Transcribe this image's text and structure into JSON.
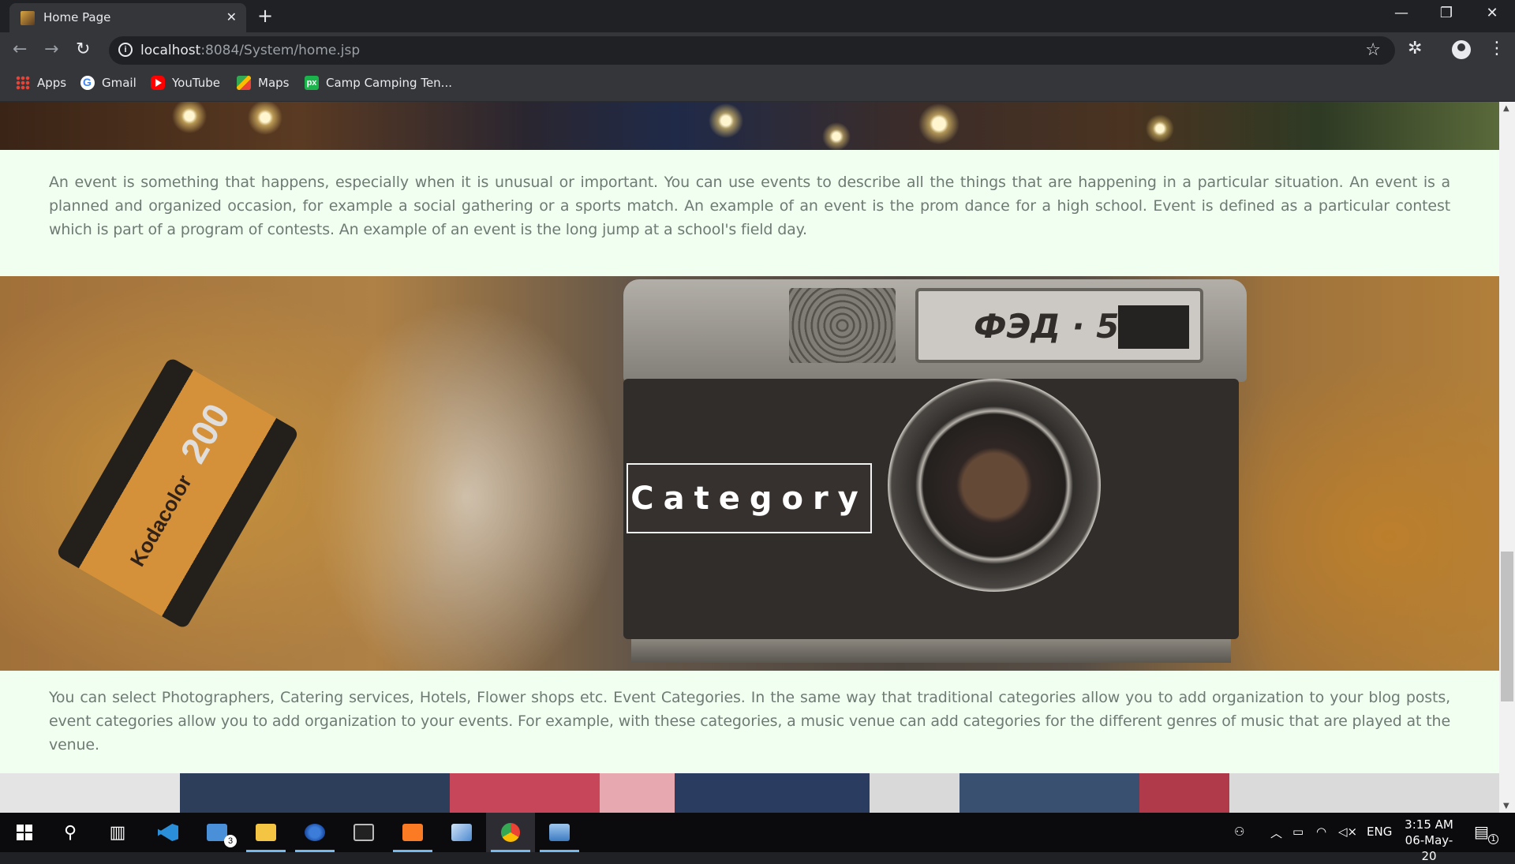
{
  "browser": {
    "tab_title": "Home Page",
    "tab_close": "✕",
    "new_tab": "+",
    "window_controls": {
      "minimize": "—",
      "restore": "❐",
      "close": "✕"
    },
    "nav": {
      "back": "←",
      "forward": "→",
      "reload": "↻"
    },
    "url_host": "localhost",
    "url_path": ":8084/System/home.jsp",
    "bookmark_star": "☆",
    "menu": "⋮"
  },
  "bookmarks": [
    {
      "label": "Apps",
      "icon": "apps-grid-icon"
    },
    {
      "label": "Gmail",
      "icon": "google-icon"
    },
    {
      "label": "YouTube",
      "icon": "youtube-icon"
    },
    {
      "label": "Maps",
      "icon": "maps-icon"
    },
    {
      "label": "Camp Camping Ten...",
      "icon": "px-icon"
    }
  ],
  "page": {
    "event_text": "An event is something that happens, especially when it is unusual or important. You can use events to describe all the things that are happening in a particular situation. An event is a planned and organized occasion, for example a social gathering or a sports match. An example of an event is the prom dance for a high school. Event is defined as a particular contest which is part of a program of contests. An example of an event is the long jump at a school's field day.",
    "category_heading": "Category",
    "category_text": "You can select Photographers, Catering services, Hotels, Flower shops etc. Event Categories. In the same way that traditional categories allow you to add organization to your blog posts, event categories allow you to add organization to your events. For example, with these categories, a music venue can add categories for the different genres of music that are played at the venue."
  },
  "hero_image_text": {
    "camera_model": "ФЭД · 5",
    "film_brand": "Kodacolor",
    "film_speed": "200"
  },
  "taskbar": {
    "mail_badge": "3",
    "tray_language": "ENG",
    "time": "3:15 AM",
    "date": "06-May-20",
    "notification_count": "1"
  },
  "colors": {
    "page_background": "#f0fff0",
    "paragraph_text": "#6f7a74",
    "browser_dark": "#202124",
    "browser_toolbar": "#35363a"
  }
}
